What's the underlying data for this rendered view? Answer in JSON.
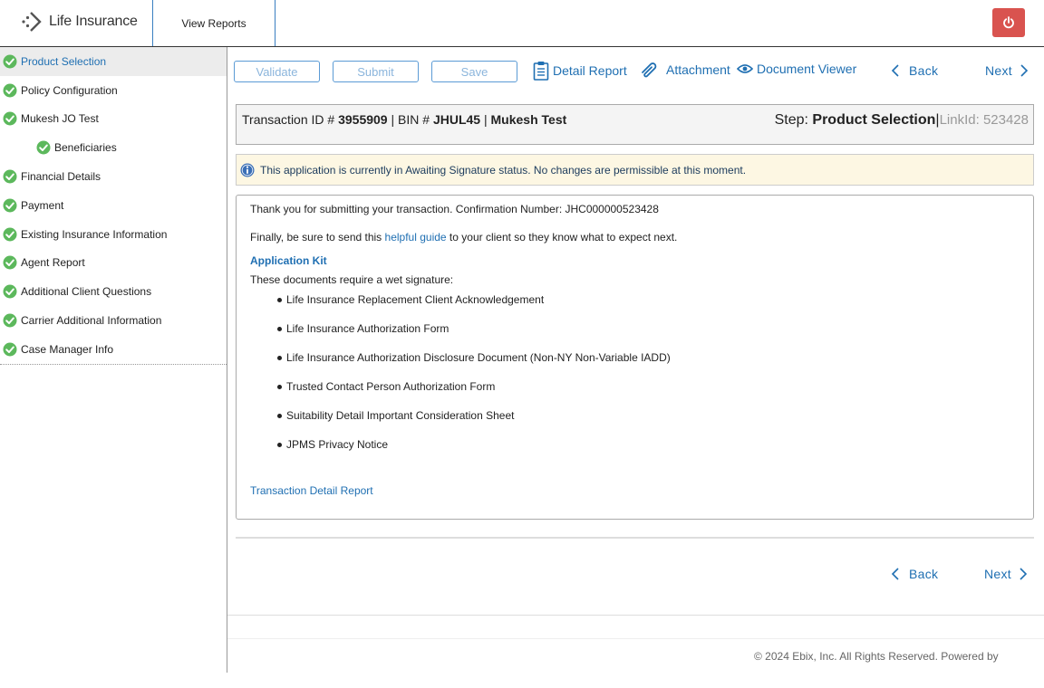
{
  "header": {
    "logo_text": "Life Insurance",
    "nav_tab": "View Reports"
  },
  "sidebar": {
    "items": [
      {
        "label": "Product Selection",
        "active": true
      },
      {
        "label": "Policy Configuration"
      },
      {
        "label": "Mukesh JO Test"
      },
      {
        "label": "Beneficiaries",
        "sub": true
      },
      {
        "label": "Financial Details"
      },
      {
        "label": "Payment"
      },
      {
        "label": "Existing Insurance Information"
      },
      {
        "label": "Agent Report"
      },
      {
        "label": "Additional Client Questions"
      },
      {
        "label": "Carrier Additional Information"
      },
      {
        "label": "Case Manager Info"
      }
    ]
  },
  "toolbar": {
    "validate": "Validate",
    "submit": "Submit",
    "save": "Save",
    "detail_report": "Detail Report",
    "attachment": "Attachment",
    "document_viewer": "Document Viewer",
    "back": "Back",
    "next": "Next"
  },
  "transaction": {
    "id_label": "Transaction ID #",
    "id_value": "3955909",
    "bin_label": "| BIN #",
    "bin_value": "JHUL45",
    "sep": "|",
    "client_name": "Mukesh Test",
    "step_label": "Step:",
    "step_value": "Product Selection",
    "step_sep": "|",
    "link_id": "LinkId: 523428"
  },
  "alert": {
    "message": "This application is currently in Awaiting Signature status. No changes are permissible at this moment."
  },
  "content": {
    "thank_you": "Thank you for submitting your transaction. Confirmation Number: JHC000000523428",
    "guide_prefix": "Finally, be sure to send this ",
    "guide_link": "helpful guide",
    "guide_suffix": " to your client so they know what to expect next.",
    "kit_heading": "Application Kit",
    "wet_signature": "These documents require a wet signature:",
    "documents": [
      "Life Insurance Replacement Client Acknowledgement",
      "Life Insurance Authorization Form",
      "Life Insurance Authorization Disclosure Document (Non-NY Non-Variable IADD)",
      "Trusted Contact Person Authorization Form",
      "Suitability Detail Important Consideration Sheet",
      "JPMS Privacy Notice"
    ],
    "detail_report_link": "Transaction Detail Report"
  },
  "bottom_nav": {
    "back": "Back",
    "next": "Next"
  },
  "footer": {
    "copyright": "© 2024 Ebix, Inc. All Rights Reserved. Powered by"
  },
  "colors": {
    "accent": "#1f6fb2",
    "check_green": "#5cb85c",
    "power_red": "#d9534f",
    "alert_bg": "#fdf7e3"
  },
  "icons": {
    "logo": "chevron-logo-icon",
    "power": "power-icon",
    "check": "check-circle-icon",
    "detail_report": "clipboard-icon",
    "attachment": "paperclip-icon",
    "document_viewer": "eye-icon",
    "info": "info-icon",
    "back": "chevron-left-icon",
    "next": "chevron-right-icon"
  }
}
